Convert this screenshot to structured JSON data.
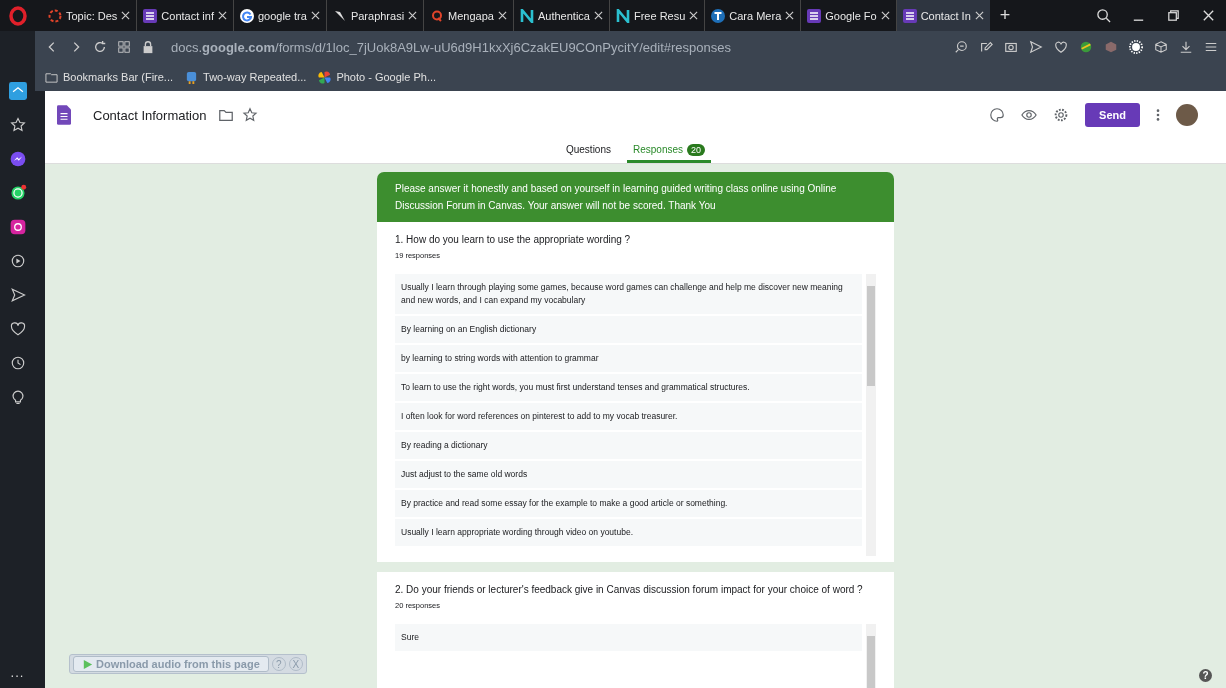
{
  "browser": {
    "tabs": [
      {
        "title": "Topic: Des",
        "selected": false
      },
      {
        "title": "Contact inf",
        "selected": false
      },
      {
        "title": "google tra",
        "selected": false
      },
      {
        "title": "Paraphrasi",
        "selected": false
      },
      {
        "title": "Mengapa",
        "selected": false
      },
      {
        "title": "Authentica",
        "selected": false
      },
      {
        "title": "Free Resu",
        "selected": false
      },
      {
        "title": "Cara Mera",
        "selected": false
      },
      {
        "title": "Google Fo",
        "selected": false
      },
      {
        "title": "Contact In",
        "selected": true
      }
    ],
    "new_tab": "+",
    "address": "docs.**google.com**/forms/d/1loc_7jUok8A9Lw-uU6d9H1kxXj6CzakEU9COnPycitY/edit#responses",
    "bookmarks": [
      "Bookmarks Bar (Fire...",
      "Two-way Repeated...",
      "Photo - Google Ph..."
    ],
    "sidebar_more": "..."
  },
  "form": {
    "title": "Contact Information",
    "send": "Send",
    "tabs": [
      {
        "label": "Questions",
        "selected": false
      },
      {
        "label": "Responses",
        "selected": true,
        "count": "20"
      }
    ],
    "banner": "Please answer it honestly and based on yourself in learning guided writing class online using Online Discussion Forum in Canvas. Your answer will not be scored. Thank You",
    "questions": [
      {
        "title": "1. How do you learn to use the appropriate wording ?",
        "count": "19 responses",
        "answers": [
          "Usually I learn through playing some games, because word games can challenge and help me discover new meaning and new words, and I can expand my vocabulary",
          "By learning on an English dictionary",
          "by learning to string words with attention to grammar",
          "To learn to use the right words, you must first understand tenses and grammatical structures.",
          "I often look for word references on pinterest to add to my vocab treasurer.",
          "By reading a dictionary",
          "Just adjust to the same old words",
          "By practice and read some essay for the example to make a good article or something.",
          "Usually I learn appropriate wording through video on youtube."
        ]
      },
      {
        "title": "2. Do your friends or lecturer's feedback give in Canvas discussion forum impact for your choice of word ?",
        "count": "20 responses",
        "answers": [
          "Sure"
        ]
      }
    ]
  },
  "extension_bar": {
    "label": "Download audio from this page",
    "help": "?",
    "close": "X"
  },
  "help_button": "?"
}
